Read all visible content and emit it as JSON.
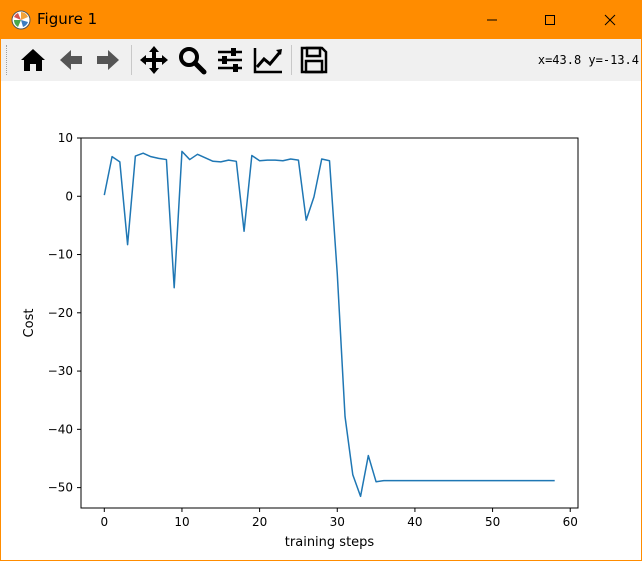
{
  "window": {
    "title": "Figure 1",
    "app_icon": "matplotlib-icon",
    "controls": [
      "minimize-icon",
      "maximize-icon",
      "close-icon"
    ],
    "accent_color": "#ff8c00"
  },
  "toolbar": {
    "buttons": [
      "home-icon",
      "back-icon",
      "forward-icon",
      "pan-icon",
      "zoom-icon",
      "configure-subplots-icon",
      "edit-axis-icon",
      "save-icon"
    ],
    "coords_text": "x=43.8  y=-13.4"
  },
  "chart_data": {
    "type": "line",
    "xlabel": "training steps",
    "ylabel": "Cost",
    "xlim": [
      -3,
      61
    ],
    "ylim": [
      -53.5,
      10
    ],
    "xticks": [
      0,
      10,
      20,
      30,
      40,
      50,
      60
    ],
    "yticks": [
      10,
      0,
      -10,
      -20,
      -30,
      -40,
      -50
    ],
    "xtick_labels": [
      "0",
      "10",
      "20",
      "30",
      "40",
      "50",
      "60"
    ],
    "ytick_labels": [
      "10",
      "0",
      "−10",
      "−20",
      "−30",
      "−40",
      "−50"
    ],
    "grid": false,
    "color": "#1f77b4",
    "series": [
      {
        "x": [
          0,
          1,
          2,
          3,
          4,
          5,
          6,
          7,
          8,
          9,
          10,
          11,
          12,
          13,
          14,
          15,
          16,
          17,
          18,
          19,
          20,
          21,
          22,
          23,
          24,
          25,
          26,
          27,
          28,
          29,
          30,
          31,
          32,
          33,
          34,
          35,
          36,
          37,
          38,
          39,
          40,
          41,
          42,
          43,
          44,
          45,
          46,
          47,
          48,
          49,
          50,
          51,
          52,
          53,
          54,
          55,
          56,
          57,
          58
        ],
        "values": [
          0.2,
          6.8,
          5.9,
          -8.3,
          6.9,
          7.4,
          6.8,
          6.5,
          6.3,
          -15.7,
          7.7,
          6.3,
          7.2,
          6.6,
          6.0,
          5.9,
          6.2,
          6.0,
          -6.0,
          7.0,
          6.1,
          6.2,
          6.2,
          6.1,
          6.4,
          6.2,
          -4.1,
          -0.1,
          6.4,
          6.1,
          -13.3,
          -37.8,
          -47.8,
          -51.5,
          -44.5,
          -49.0,
          -48.8,
          -48.8,
          -48.8,
          -48.8,
          -48.8,
          -48.8,
          -48.8,
          -48.8,
          -48.8,
          -48.8,
          -48.8,
          -48.8,
          -48.8,
          -48.8,
          -48.8,
          -48.8,
          -48.8,
          -48.8,
          -48.8,
          -48.8,
          -48.8,
          -48.8,
          -48.8
        ]
      }
    ]
  }
}
